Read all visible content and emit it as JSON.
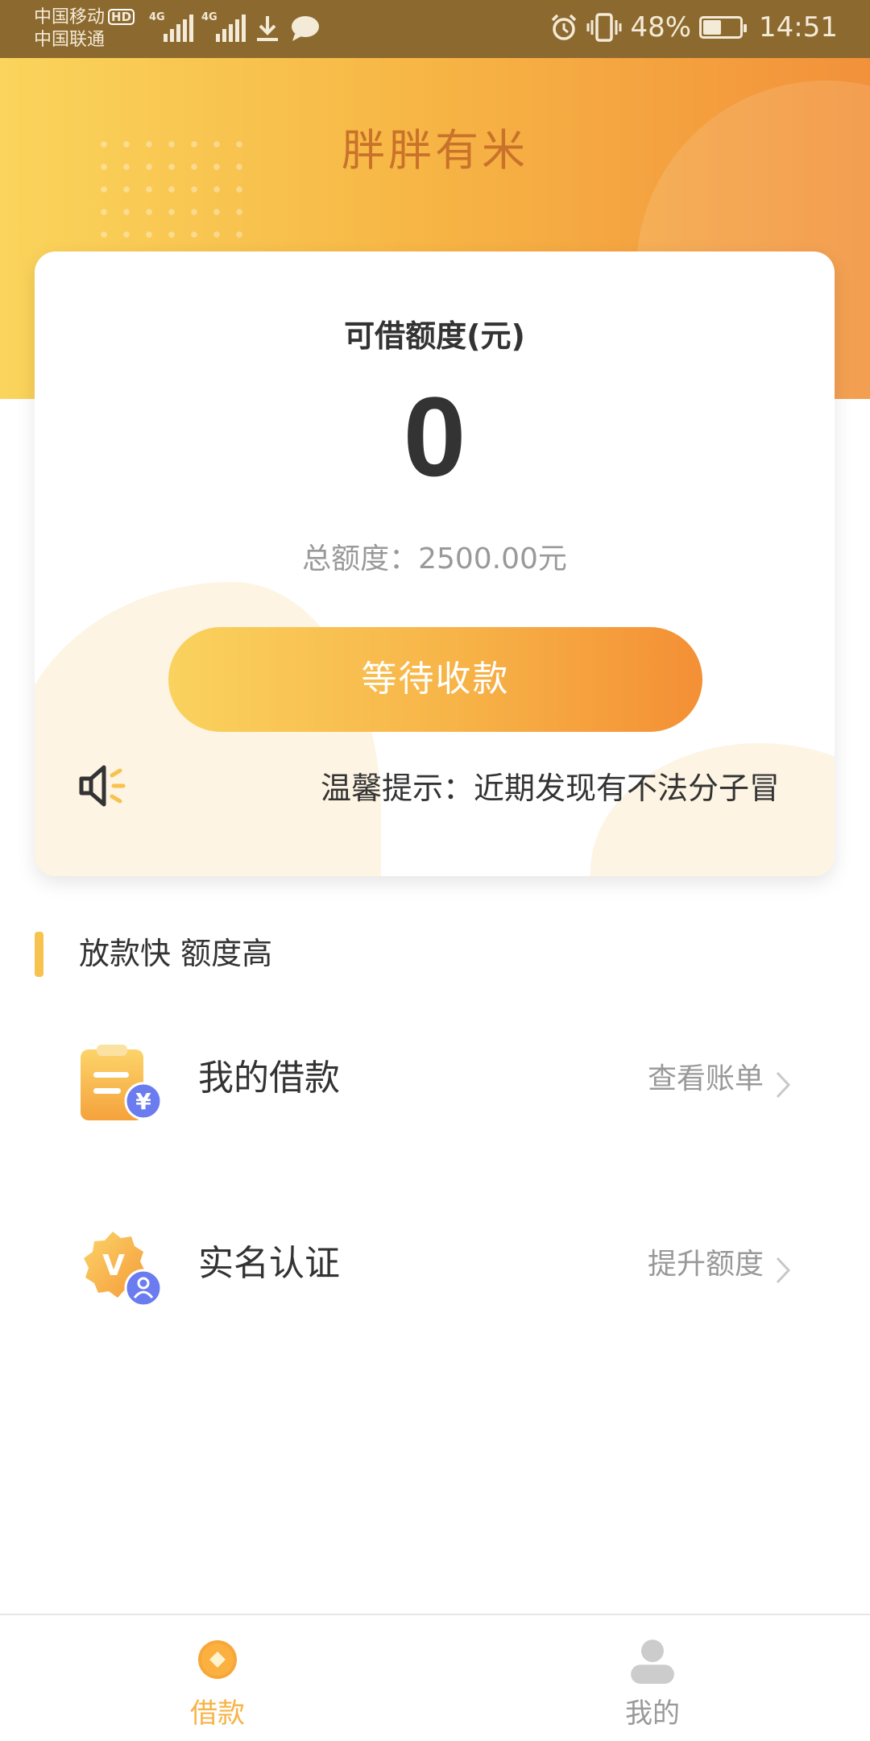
{
  "status_bar": {
    "carrier_1": "中国移动",
    "carrier_2": "中国联通",
    "hd": "HD",
    "network_1": "4G",
    "network_2": "4G",
    "battery": "48%",
    "time": "14:51"
  },
  "header": {
    "app_title": "胖胖有米"
  },
  "card": {
    "label": "可借额度(元)",
    "amount": "0",
    "total": "总额度：2500.00元",
    "button_label": "等待收款",
    "notice": "温馨提示：近期发现有不法分子冒"
  },
  "section": {
    "title": "放款快 额度高"
  },
  "rows": [
    {
      "title": "我的借款",
      "action": "查看账单",
      "icon": "loan-document-icon"
    },
    {
      "title": "实名认证",
      "action": "提升额度",
      "icon": "verify-badge-icon"
    }
  ],
  "bottom_nav": {
    "items": [
      {
        "label": "借款",
        "icon": "loan-tab-icon",
        "active": true
      },
      {
        "label": "我的",
        "icon": "profile-icon",
        "active": false
      }
    ]
  },
  "colors": {
    "accent": "#f7b347",
    "accent_dark": "#f48f35",
    "title_brown": "#c9722a",
    "text_gray": "#999999"
  }
}
